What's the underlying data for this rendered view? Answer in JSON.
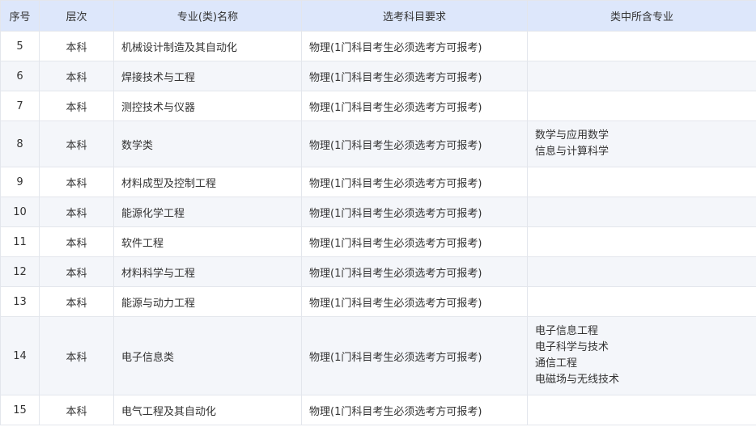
{
  "headers": [
    "序号",
    "层次",
    "专业(类)名称",
    "选考科目要求",
    "类中所含专业"
  ],
  "rows": [
    {
      "no": "5",
      "level": "本科",
      "major": "机械设计制造及其自动化",
      "requirement": "物理(1门科目考生必须选考方可报考)",
      "sub_majors": []
    },
    {
      "no": "6",
      "level": "本科",
      "major": "焊接技术与工程",
      "requirement": "物理(1门科目考生必须选考方可报考)",
      "sub_majors": []
    },
    {
      "no": "7",
      "level": "本科",
      "major": "测控技术与仪器",
      "requirement": "物理(1门科目考生必须选考方可报考)",
      "sub_majors": []
    },
    {
      "no": "8",
      "level": "本科",
      "major": "数学类",
      "requirement": "物理(1门科目考生必须选考方可报考)",
      "sub_majors": [
        "数学与应用数学",
        "信息与计算科学"
      ]
    },
    {
      "no": "9",
      "level": "本科",
      "major": "材料成型及控制工程",
      "requirement": "物理(1门科目考生必须选考方可报考)",
      "sub_majors": []
    },
    {
      "no": "10",
      "level": "本科",
      "major": "能源化学工程",
      "requirement": "物理(1门科目考生必须选考方可报考)",
      "sub_majors": []
    },
    {
      "no": "11",
      "level": "本科",
      "major": "软件工程",
      "requirement": "物理(1门科目考生必须选考方可报考)",
      "sub_majors": []
    },
    {
      "no": "12",
      "level": "本科",
      "major": "材料科学与工程",
      "requirement": "物理(1门科目考生必须选考方可报考)",
      "sub_majors": []
    },
    {
      "no": "13",
      "level": "本科",
      "major": "能源与动力工程",
      "requirement": "物理(1门科目考生必须选考方可报考)",
      "sub_majors": []
    },
    {
      "no": "14",
      "level": "本科",
      "major": "电子信息类",
      "requirement": "物理(1门科目考生必须选考方可报考)",
      "sub_majors": [
        "电子信息工程",
        "电子科学与技术",
        "通信工程",
        "电磁场与无线技术"
      ]
    },
    {
      "no": "15",
      "level": "本科",
      "major": "电气工程及其自动化",
      "requirement": "物理(1门科目考生必须选考方可报考)",
      "sub_majors": []
    }
  ]
}
